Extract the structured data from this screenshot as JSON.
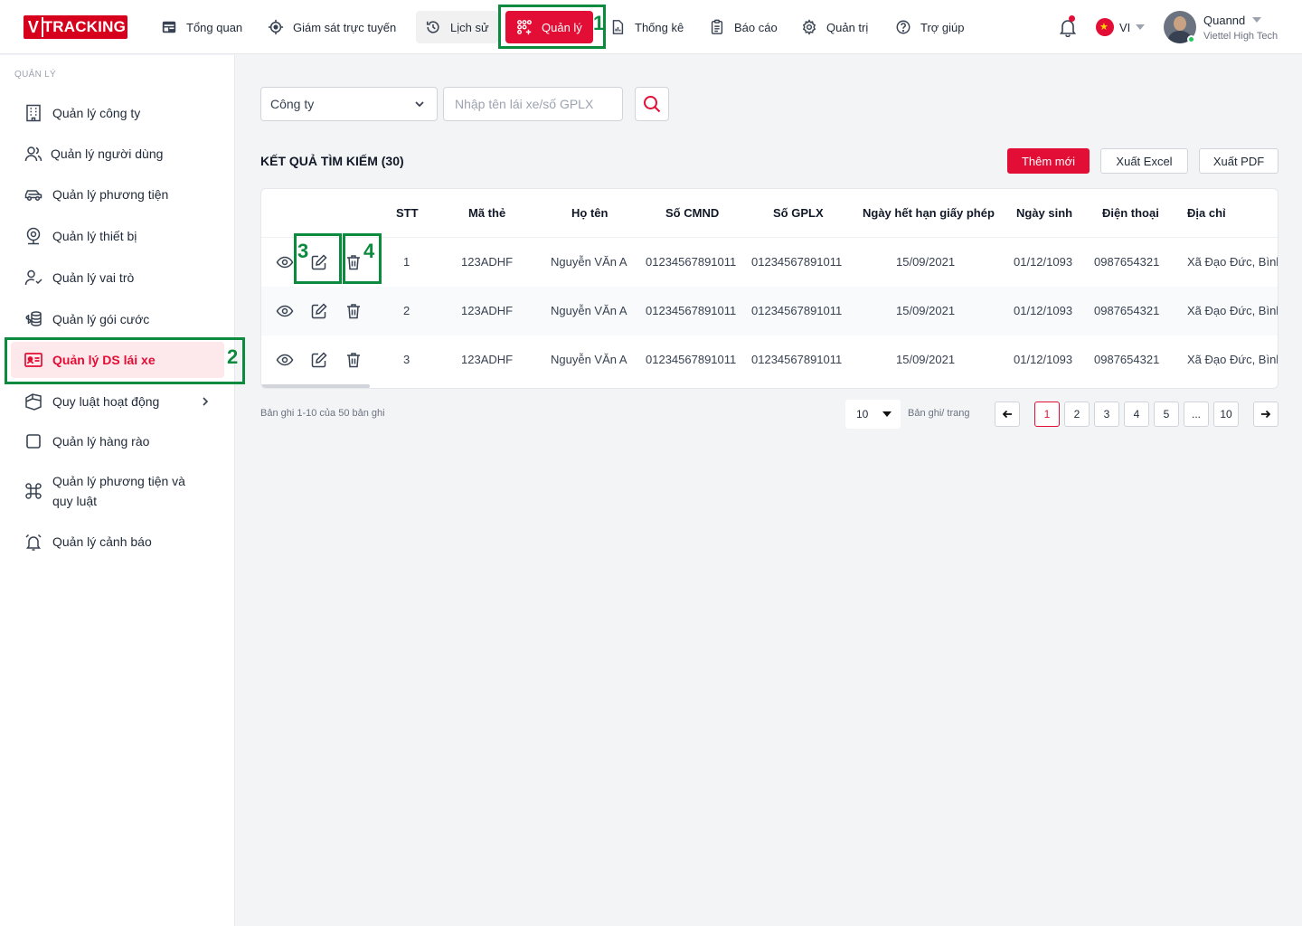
{
  "header": {
    "logo": {
      "v": "V",
      "text": "TRACKING"
    },
    "nav": [
      {
        "label": "Tổng quan",
        "icon": "dashboard-icon"
      },
      {
        "label": "Giám sát trực tuyến",
        "icon": "crosshair-icon"
      },
      {
        "label": "Lịch sử",
        "icon": "history-icon"
      },
      {
        "label": "Quản lý",
        "icon": "manage-icon"
      },
      {
        "label": "Thống kê",
        "icon": "stats-icon"
      },
      {
        "label": "Báo cáo",
        "icon": "report-icon"
      },
      {
        "label": "Quản trị",
        "icon": "gear-icon"
      },
      {
        "label": "Trợ giúp",
        "icon": "help-icon"
      }
    ],
    "language": "VI",
    "user": {
      "name": "Quannd",
      "org": "Viettel High Tech"
    }
  },
  "sidebar": {
    "section_title": "QUẢN LÝ",
    "items": [
      {
        "label": "Quản lý công ty",
        "icon": "building-icon"
      },
      {
        "label": "Quản lý người dùng",
        "icon": "users-icon"
      },
      {
        "label": "Quản lý phương tiện",
        "icon": "car-icon"
      },
      {
        "label": "Quản lý thiết bị",
        "icon": "device-icon"
      },
      {
        "label": "Quản lý vai trò",
        "icon": "user-check-icon"
      },
      {
        "label": "Quản lý gói cước",
        "icon": "coins-icon"
      },
      {
        "label": "Quản lý DS lái xe",
        "icon": "id-card-icon"
      },
      {
        "label": "Quy luật hoạt động",
        "icon": "rules-icon"
      },
      {
        "label": "Quản lý hàng rào",
        "icon": "square-icon"
      },
      {
        "label": "Quản lý phương tiện và",
        "label2": "quy luật",
        "icon": "command-icon"
      },
      {
        "label": "Quản lý cảnh báo",
        "icon": "alarm-icon"
      }
    ]
  },
  "filters": {
    "company_label": "Công ty",
    "search_placeholder": "Nhập tên lái xe/số GPLX"
  },
  "results": {
    "title": "KẾT QUẢ TÌM KIẾM (30)",
    "add_label": "Thêm mới",
    "excel_label": "Xuất Excel",
    "pdf_label": "Xuất PDF"
  },
  "table": {
    "columns": [
      "STT",
      "Mã thẻ",
      "Họ tên",
      "Số CMND",
      "Số GPLX",
      "Ngày hết hạn giấy phép",
      "Ngày sinh",
      "Điện thoại",
      "Địa chỉ"
    ],
    "rows": [
      [
        "1",
        "123ADHF",
        "Nguyễn VĂn A",
        "01234567891011",
        "01234567891011",
        "15/09/2021",
        "01/12/1093",
        "0987654321",
        "Xã Đạo Đức, Bình"
      ],
      [
        "2",
        "123ADHF",
        "Nguyễn VĂn A",
        "01234567891011",
        "01234567891011",
        "15/09/2021",
        "01/12/1093",
        "0987654321",
        "Xã Đạo Đức, Bình"
      ],
      [
        "3",
        "123ADHF",
        "Nguyễn VĂn A",
        "01234567891011",
        "01234567891011",
        "15/09/2021",
        "01/12/1093",
        "0987654321",
        "Xã Đạo Đức, Bình"
      ]
    ]
  },
  "pagination": {
    "info": "Bản ghi 1-10 của 50 bản ghi",
    "per_page": "10",
    "per_page_label": "Bản ghi/ trang",
    "pages": [
      "1",
      "2",
      "3",
      "4",
      "5",
      "...",
      "10"
    ],
    "current": "1"
  },
  "annotations": [
    "1",
    "2",
    "3",
    "4"
  ],
  "colors": {
    "accent": "#e30e35",
    "annotation": "#0c8a3e"
  }
}
